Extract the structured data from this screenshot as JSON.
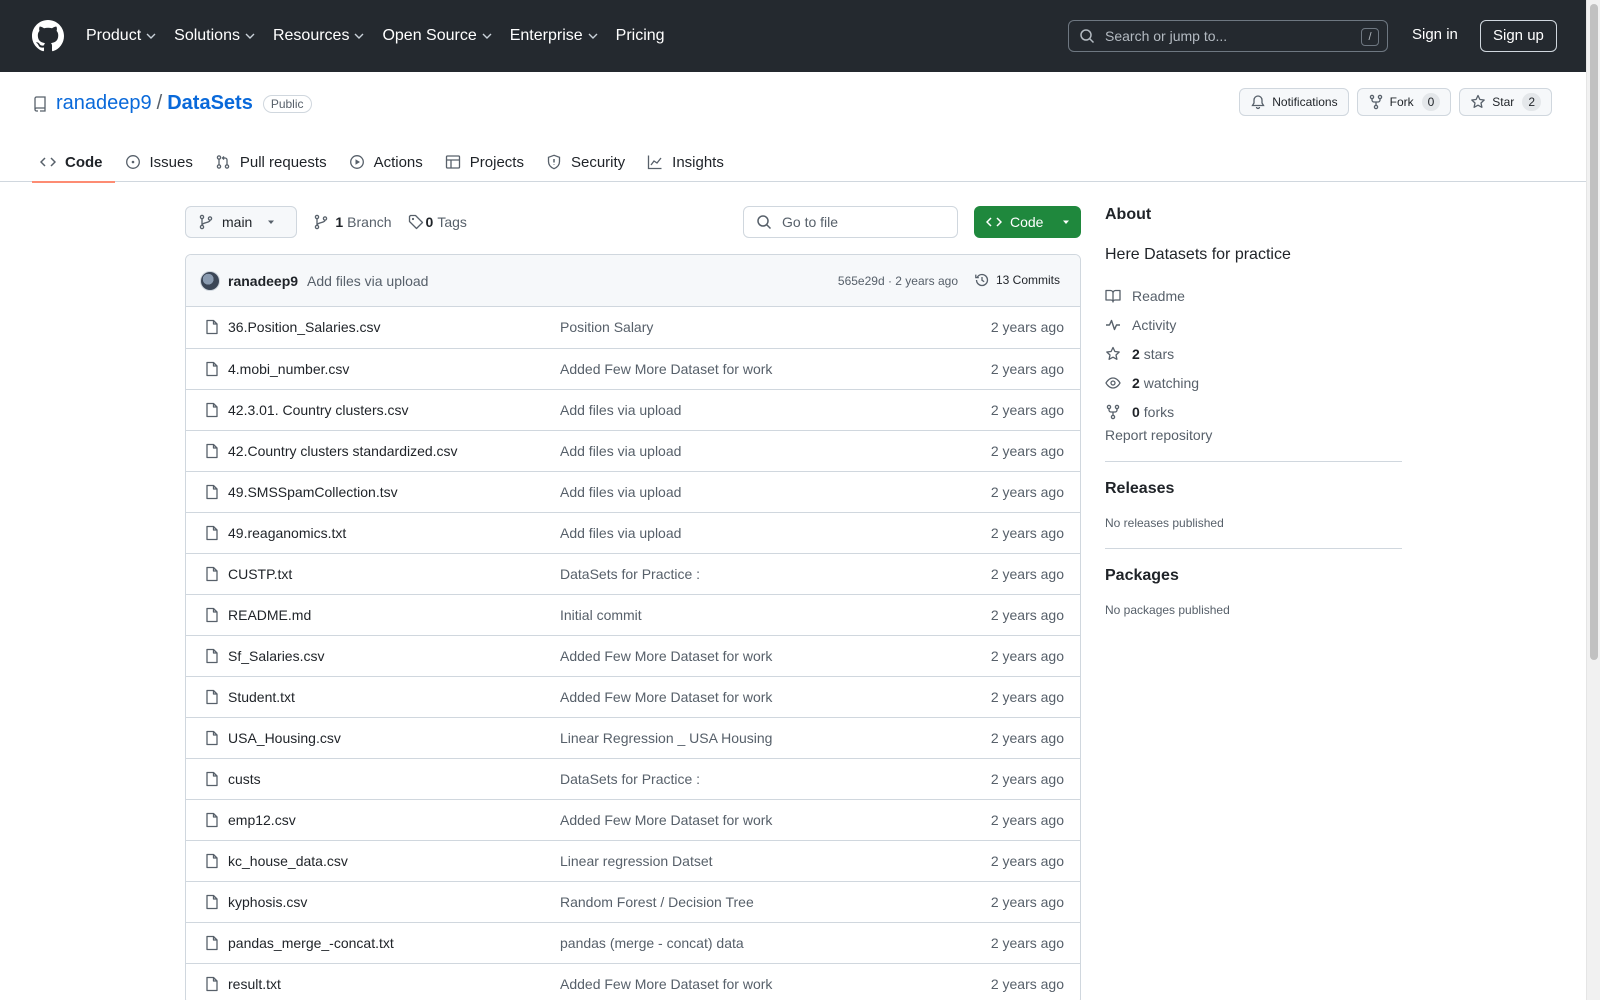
{
  "header": {
    "nav": [
      {
        "label": "Product",
        "dropdown": true
      },
      {
        "label": "Solutions",
        "dropdown": true
      },
      {
        "label": "Resources",
        "dropdown": true
      },
      {
        "label": "Open Source",
        "dropdown": true
      },
      {
        "label": "Enterprise",
        "dropdown": true
      },
      {
        "label": "Pricing",
        "dropdown": false
      }
    ],
    "search_placeholder": "Search or jump to...",
    "search_shortcut": "/",
    "sign_in": "Sign in",
    "sign_up": "Sign up"
  },
  "repo": {
    "owner": "ranadeep9",
    "separator": "/",
    "name": "DataSets",
    "visibility": "Public",
    "notifications_label": "Notifications",
    "fork_label": "Fork",
    "fork_count": "0",
    "star_label": "Star",
    "star_count": "2",
    "tabs": [
      {
        "label": "Code",
        "icon": "code-icon",
        "active": true
      },
      {
        "label": "Issues",
        "icon": "issue-icon",
        "active": false
      },
      {
        "label": "Pull requests",
        "icon": "pull-request-icon",
        "active": false
      },
      {
        "label": "Actions",
        "icon": "play-icon",
        "active": false
      },
      {
        "label": "Projects",
        "icon": "table-icon",
        "active": false
      },
      {
        "label": "Security",
        "icon": "shield-icon",
        "active": false
      },
      {
        "label": "Insights",
        "icon": "graph-icon",
        "active": false
      }
    ]
  },
  "toolbar": {
    "branch": "main",
    "branch_count": "1",
    "branch_label": "Branch",
    "tag_count": "0",
    "tag_label": "Tags",
    "goto_placeholder": "Go to file",
    "code_button": "Code"
  },
  "latest_commit": {
    "author": "ranadeep9",
    "message": "Add files via upload",
    "meta": "565e29d · 2 years ago",
    "commits": "13 Commits"
  },
  "files": [
    {
      "name": "36.Position_Salaries.csv",
      "message": "Position Salary",
      "date": "2 years ago"
    },
    {
      "name": "4.mobi_number.csv",
      "message": "Added Few More Dataset for work",
      "date": "2 years ago"
    },
    {
      "name": "42.3.01. Country clusters.csv",
      "message": "Add files via upload",
      "date": "2 years ago"
    },
    {
      "name": "42.Country clusters standardized.csv",
      "message": "Add files via upload",
      "date": "2 years ago"
    },
    {
      "name": "49.SMSSpamCollection.tsv",
      "message": "Add files via upload",
      "date": "2 years ago"
    },
    {
      "name": "49.reaganomics.txt",
      "message": "Add files via upload",
      "date": "2 years ago"
    },
    {
      "name": "CUSTP.txt",
      "message": "DataSets for Practice :",
      "date": "2 years ago"
    },
    {
      "name": "README.md",
      "message": "Initial commit",
      "date": "2 years ago"
    },
    {
      "name": "Sf_Salaries.csv",
      "message": "Added Few More Dataset for work",
      "date": "2 years ago"
    },
    {
      "name": "Student.txt",
      "message": "Added Few More Dataset for work",
      "date": "2 years ago"
    },
    {
      "name": "USA_Housing.csv",
      "message": "Linear Regression _ USA Housing",
      "date": "2 years ago"
    },
    {
      "name": "custs",
      "message": "DataSets for Practice :",
      "date": "2 years ago"
    },
    {
      "name": "emp12.csv",
      "message": "Added Few More Dataset for work",
      "date": "2 years ago"
    },
    {
      "name": "kc_house_data.csv",
      "message": "Linear regression Datset",
      "date": "2 years ago"
    },
    {
      "name": "kyphosis.csv",
      "message": "Random Forest / Decision Tree",
      "date": "2 years ago"
    },
    {
      "name": "pandas_merge_-concat.txt",
      "message": "pandas (merge - concat) data",
      "date": "2 years ago"
    },
    {
      "name": "result.txt",
      "message": "Added Few More Dataset for work",
      "date": "2 years ago"
    }
  ],
  "sidebar": {
    "about_title": "About",
    "description": "Here Datasets for practice",
    "readme": "Readme",
    "activity": "Activity",
    "stars_count": "2",
    "stars_label": "stars",
    "watching_count": "2",
    "watching_label": "watching",
    "forks_count": "0",
    "forks_label": "forks",
    "report": "Report repository",
    "releases_title": "Releases",
    "releases_empty": "No releases published",
    "packages_title": "Packages",
    "packages_empty": "No packages published"
  },
  "colors": {
    "header_bg": "#24292f",
    "link": "#0969da",
    "code_button": "#1f883d",
    "active_tab": "#fd8c73"
  }
}
